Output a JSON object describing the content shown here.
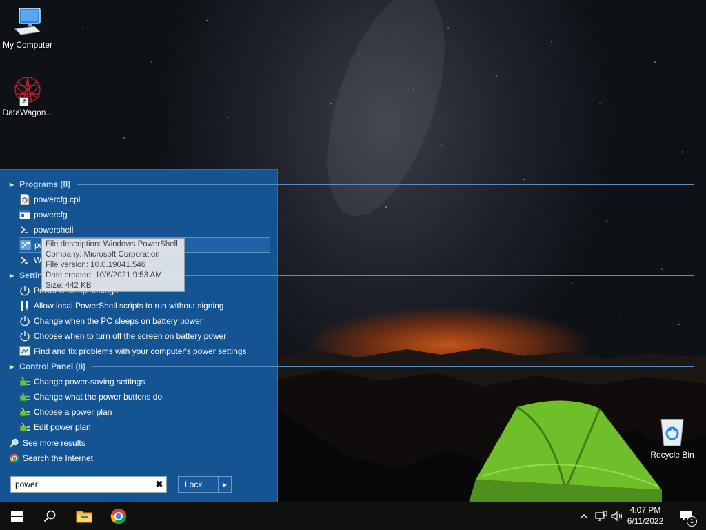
{
  "desktop": {
    "icons": [
      {
        "label": "My Computer"
      },
      {
        "label": "DataWagon..."
      },
      {
        "label": "Recycle Bin"
      }
    ]
  },
  "start_menu": {
    "sections": {
      "programs": "Programs (8)",
      "settings": "Settings",
      "control_panel": "Control Panel (8)"
    },
    "programs": [
      {
        "label": "powercfg.cpl"
      },
      {
        "label": "powercfg"
      },
      {
        "label": "powershell"
      },
      {
        "label": "po"
      },
      {
        "label": "W"
      }
    ],
    "settings": [
      {
        "label": "Power & sleep settings"
      },
      {
        "label": "Allow local PowerShell scripts to run without signing"
      },
      {
        "label": "Change when the PC sleeps on battery power"
      },
      {
        "label": "Choose when to turn off the screen on battery power"
      },
      {
        "label": "Find and fix problems with your computer's power settings"
      }
    ],
    "control_panel": [
      {
        "label": "Change power-saving settings"
      },
      {
        "label": "Change what the power buttons do"
      },
      {
        "label": "Choose a power plan"
      },
      {
        "label": "Edit power plan"
      }
    ],
    "see_more": "See more results",
    "search_internet": "Search the Internet",
    "search": {
      "value": "power"
    },
    "lock_label": "Lock"
  },
  "tooltip": {
    "line1": "File description: Windows PowerShell",
    "line2": "Company: Microsoft Corporation",
    "line3": "File version: 10.0.19041.546",
    "line4": "Date created: 10/6/2021 9:53 AM",
    "line5": "Size: 442 KB"
  },
  "taskbar": {
    "time": "4:07 PM",
    "date": "6/11/2022",
    "notification_count": "1"
  },
  "colors": {
    "menu_bg": "#145493",
    "section_text": "#b9d6f5",
    "taskbar_bg": "#101010"
  }
}
